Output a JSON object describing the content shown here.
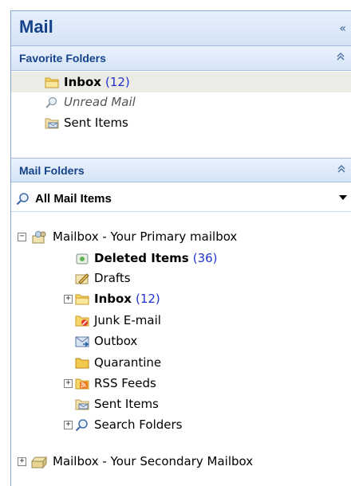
{
  "pane": {
    "title": "Mail",
    "collapse_glyph": "«"
  },
  "favorites": {
    "header": "Favorite Folders",
    "chevron": "⌃",
    "items": [
      {
        "label": "Inbox",
        "count": "(12)",
        "icon": "inbox-folder-icon"
      },
      {
        "label": "Unread Mail",
        "icon": "search-folder-icon"
      },
      {
        "label": "Sent Items",
        "icon": "sent-items-icon"
      }
    ]
  },
  "mail_folders": {
    "header": "Mail Folders",
    "chevron": "⌃",
    "view_selector": "All Mail Items",
    "tree": {
      "primary_mailbox": "Mailbox -  Your Primary mailbox",
      "children": [
        {
          "label": "Deleted Items",
          "count": "(36)",
          "icon": "deleted-items-icon"
        },
        {
          "label": "Drafts",
          "icon": "drafts-icon"
        },
        {
          "label": "Inbox",
          "count": "(12)",
          "icon": "inbox-folder-icon"
        },
        {
          "label": "Junk E-mail",
          "icon": "junk-mail-icon"
        },
        {
          "label": "Outbox",
          "icon": "outbox-icon"
        },
        {
          "label": "Quarantine",
          "icon": "folder-icon"
        },
        {
          "label": "RSS Feeds",
          "icon": "rss-feeds-icon"
        },
        {
          "label": "Sent Items",
          "icon": "sent-items-icon"
        },
        {
          "label": "Search Folders",
          "icon": "search-folder-icon"
        }
      ],
      "secondary_mailbox": "Mailbox -  Your Secondary Mailbox"
    }
  },
  "expander_glyphs": {
    "collapsed": "+",
    "expanded": "−"
  }
}
